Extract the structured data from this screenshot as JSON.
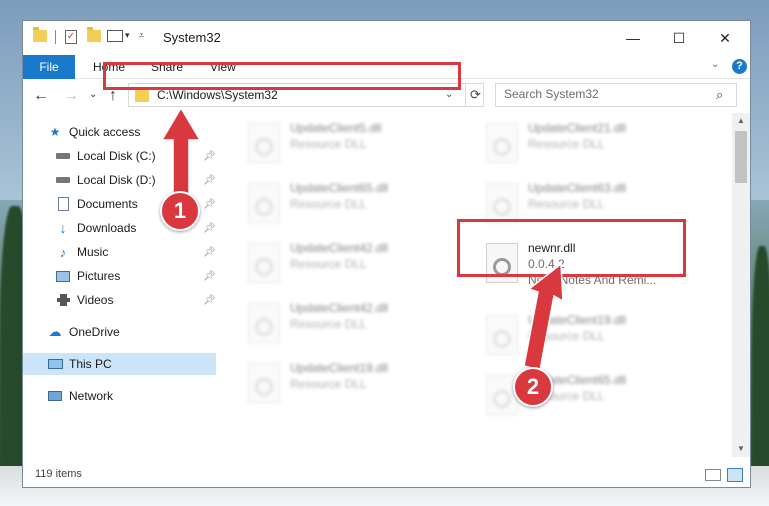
{
  "window": {
    "title": "System32",
    "controls": {
      "minimize": "—",
      "maximize": "☐",
      "close": "✕"
    }
  },
  "ribbon": {
    "tabs": [
      {
        "label": "File",
        "active": true
      },
      {
        "label": "Home"
      },
      {
        "label": "Share"
      },
      {
        "label": "View"
      }
    ],
    "help": "?"
  },
  "navigation": {
    "address": "C:\\Windows\\System32",
    "search_placeholder": "Search System32"
  },
  "sidebar": {
    "items": [
      {
        "label": "Quick access",
        "icon": "star-icon",
        "pinned": false
      },
      {
        "label": "Local Disk (C:)",
        "icon": "drive-icon",
        "pinned": true
      },
      {
        "label": "Local Disk (D:)",
        "icon": "drive-icon",
        "pinned": true
      },
      {
        "label": "Documents",
        "icon": "documents-icon",
        "pinned": true
      },
      {
        "label": "Downloads",
        "icon": "download-icon",
        "pinned": true
      },
      {
        "label": "Music",
        "icon": "music-icon",
        "pinned": true
      },
      {
        "label": "Pictures",
        "icon": "pictures-icon",
        "pinned": true
      },
      {
        "label": "Videos",
        "icon": "videos-icon",
        "pinned": true
      },
      {
        "label": "OneDrive",
        "icon": "cloud-icon",
        "pinned": false
      },
      {
        "label": "This PC",
        "icon": "computer-icon",
        "pinned": false,
        "selected": true
      },
      {
        "label": "Network",
        "icon": "network-icon",
        "pinned": false
      }
    ]
  },
  "files": [
    {
      "name": "UpdateClient5.dll",
      "type": "Resource DLL",
      "blurred": true
    },
    {
      "name": "UpdateClient21.dll",
      "type": "Resource DLL",
      "blurred": true
    },
    {
      "name": "UpdateClient65.dll",
      "type": "Resource DLL",
      "blurred": true
    },
    {
      "name": "UpdateClient63.dll",
      "type": "Resource DLL",
      "blurred": true
    },
    {
      "name": "UpdateClient42.dll",
      "type": "Resource DLL",
      "blurred": true
    },
    {
      "name": "newnr.dll",
      "version": "0.0.4.2",
      "description": "New \"Notes And Remi...",
      "blurred": false
    },
    {
      "name": "UpdateClient42.dll",
      "type": "Resource DLL",
      "blurred": true
    },
    {
      "name": "UpdateClient19.dll",
      "type": "Resource DLL",
      "blurred": true
    },
    {
      "name": "UpdateClient19.dll",
      "type": "Resource DLL",
      "blurred": true
    },
    {
      "name": "UpdateClient65.dll",
      "type": "Resource DLL",
      "blurred": true
    }
  ],
  "status": {
    "item_count": "119 items"
  },
  "annotations": {
    "marker1": "1",
    "marker2": "2",
    "color": "#d9393e"
  },
  "colors": {
    "accent": "#1979ca",
    "highlight": "#d9393e",
    "selection": "#cce4f7"
  }
}
